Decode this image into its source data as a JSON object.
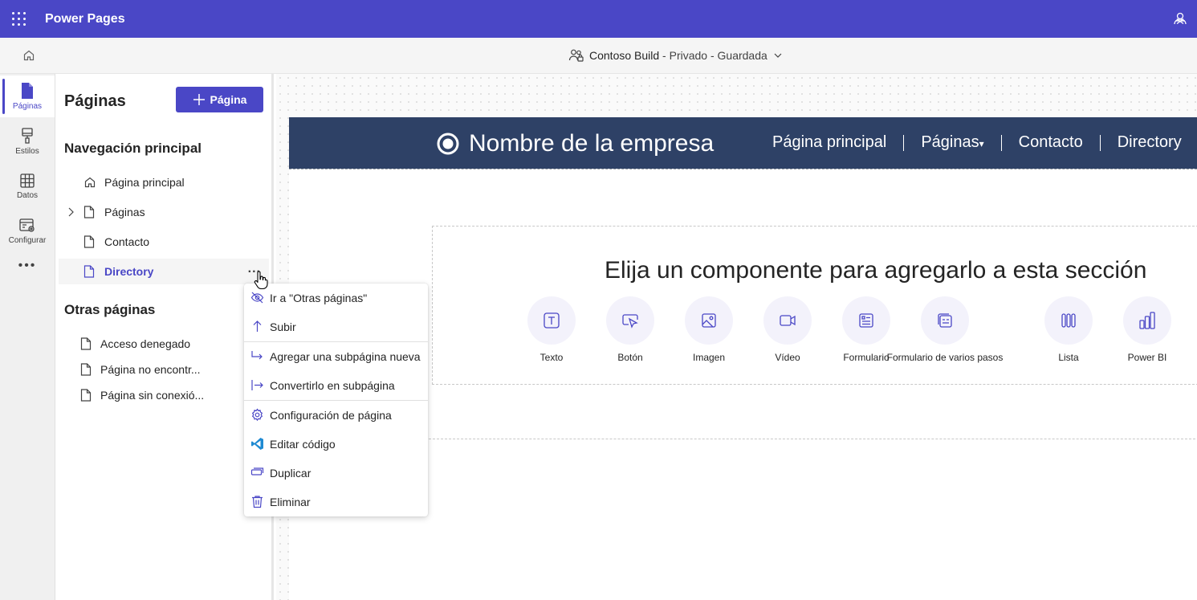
{
  "app": {
    "title": "Power Pages"
  },
  "cmdbar": {
    "site_name": "Contoso Build",
    "site_status": " - Privado - Guardada"
  },
  "rail": [
    {
      "label": "Páginas",
      "icon": "page-icon"
    },
    {
      "label": "Estilos",
      "icon": "brush-icon"
    },
    {
      "label": "Datos",
      "icon": "table-icon"
    },
    {
      "label": "Configurar",
      "icon": "settings-icon"
    }
  ],
  "panel": {
    "title": "Páginas",
    "add_label": "Página",
    "main_nav_heading": "Navegación principal",
    "main_nav": [
      {
        "label": "Página principal",
        "icon": "home-icon"
      },
      {
        "label": "Páginas",
        "icon": "page-icon"
      },
      {
        "label": "Contacto",
        "icon": "page-icon"
      },
      {
        "label": "Directory",
        "icon": "page-icon"
      }
    ],
    "more_label": "...",
    "other_heading": "Otras páginas",
    "other_pages": [
      {
        "label": "Acceso denegado"
      },
      {
        "label": "Página no encontr..."
      },
      {
        "label": "Página sin conexió..."
      }
    ]
  },
  "context_menu": [
    {
      "label": "Ir a \"Otras páginas\"",
      "icon": "eye-off-icon"
    },
    {
      "label": "Subir",
      "icon": "arrow-up-icon"
    },
    {
      "label": "Agregar una subpágina nueva",
      "icon": "add-subpage-icon"
    },
    {
      "label": "Convertirlo en subpágina",
      "icon": "indent-icon"
    },
    {
      "label": "Configuración de página",
      "icon": "gear-icon"
    },
    {
      "label": "Editar código",
      "icon": "vscode-icon"
    },
    {
      "label": "Duplicar",
      "icon": "duplicate-icon"
    },
    {
      "label": "Eliminar",
      "icon": "trash-icon"
    }
  ],
  "site": {
    "company": "Nombre de la empresa",
    "nav": [
      "Página principal",
      "Páginas",
      "Contacto",
      "Directory"
    ]
  },
  "section": {
    "prompt": "Elija un componente para agregarlo a esta sección",
    "components": [
      {
        "label": "Texto",
        "icon": "text-icon"
      },
      {
        "label": "Botón",
        "icon": "button-icon"
      },
      {
        "label": "Imagen",
        "icon": "image-icon"
      },
      {
        "label": "Vídeo",
        "icon": "video-icon"
      },
      {
        "label": "Formulario",
        "icon": "form-icon"
      },
      {
        "label": "Formulario de varios pasos",
        "icon": "multistep-form-icon"
      },
      {
        "label": "Lista",
        "icon": "list-icon"
      },
      {
        "label": "Power BI",
        "icon": "powerbi-icon"
      }
    ]
  },
  "colors": {
    "brand": "#4a47c6",
    "site_header": "#2e4166"
  }
}
